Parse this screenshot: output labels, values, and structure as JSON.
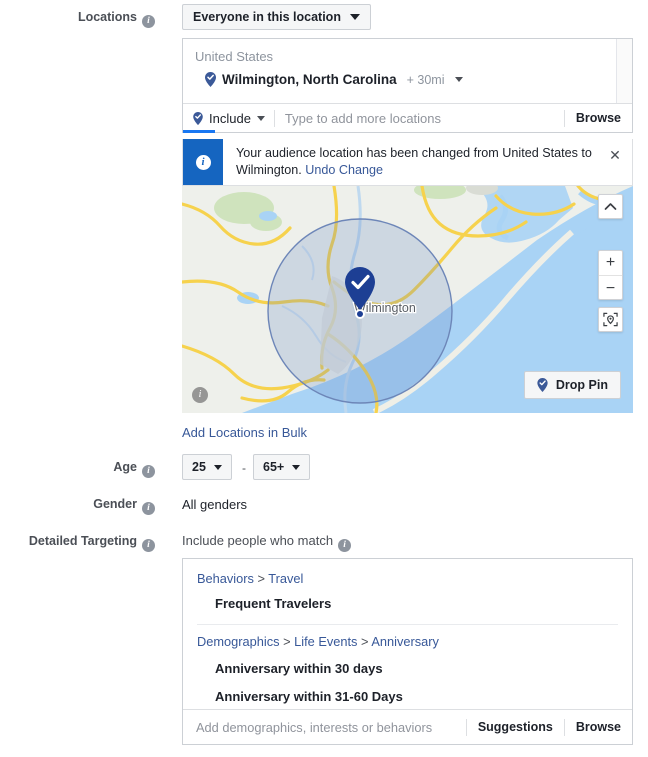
{
  "locations": {
    "label": "Locations",
    "audience_type": "Everyone in this location",
    "country_group": "United States",
    "selected_location": "Wilmington, North Carolina",
    "radius": "+ 30mi",
    "include_label": "Include",
    "input_placeholder": "Type to add more locations",
    "browse_label": "Browse",
    "bulk_link": "Add Locations in Bulk",
    "pin_icon": "map-pin-check-icon",
    "banner": {
      "icon": "info-circle-icon",
      "text": "Your audience location has been changed from United States to Wilmington.",
      "undo_label": "Undo Change",
      "close_icon": "close-icon"
    },
    "map": {
      "city_label": "Wilmington",
      "collapse_icon": "chevron-up-icon",
      "zoom_in_label": "+",
      "zoom_out_label": "−",
      "locate_icon": "locate-target-icon",
      "drop_pin_label": "Drop Pin",
      "attribution_icon": "info-icon"
    }
  },
  "age": {
    "label": "Age",
    "min": "25",
    "max": "65+",
    "separator": "-"
  },
  "gender": {
    "label": "Gender",
    "value": "All genders"
  },
  "detailed_targeting": {
    "label": "Detailed Targeting",
    "subtitle": "Include people who match",
    "groups": [
      {
        "path": [
          "Behaviors",
          "Travel"
        ],
        "items": [
          "Frequent Travelers"
        ]
      },
      {
        "path": [
          "Demographics",
          "Life Events",
          "Anniversary"
        ],
        "items": [
          "Anniversary within 30 days",
          "Anniversary within 31-60 Days"
        ]
      }
    ],
    "input_placeholder": "Add demographics, interests or behaviors",
    "suggestions_label": "Suggestions",
    "browse_label": "Browse"
  },
  "colors": {
    "accent_blue": "#1877f2",
    "link_blue": "#385898",
    "banner_blue": "#1565c0",
    "pin_blue": "#1d3f94",
    "water": "#a9d3f5",
    "road": "#f6d24d"
  }
}
